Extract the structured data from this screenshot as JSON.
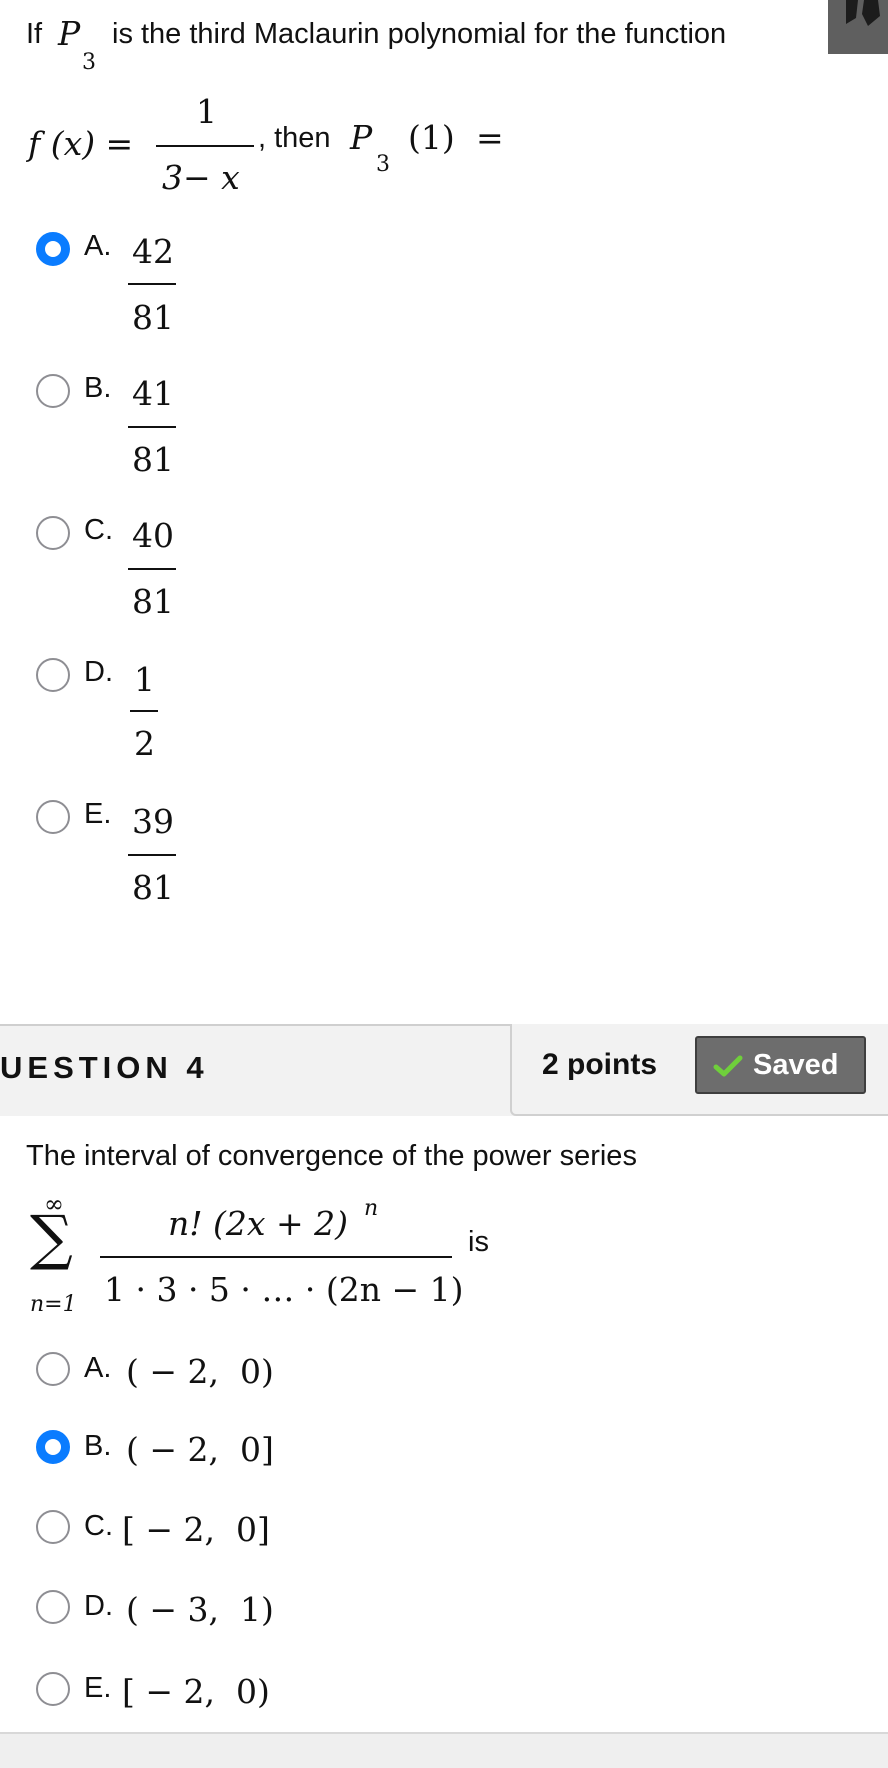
{
  "question3": {
    "text_if": "If",
    "p_symbol": "P",
    "p_subscript": "3",
    "text_rest": "is the third Maclaurin polynomial for the function",
    "f_lhs": "f (x) =",
    "f_num": "1",
    "f_den": "3− x",
    "text_then": ", then",
    "p_eval_symbol": "P",
    "p_eval_subscript": "3",
    "p_eval_arg": "(1)",
    "equals": "=",
    "options": [
      {
        "label": "A.",
        "num": "42",
        "den": "81",
        "selected": true
      },
      {
        "label": "B.",
        "num": "41",
        "den": "81",
        "selected": false
      },
      {
        "label": "C.",
        "num": "40",
        "den": "81",
        "selected": false
      },
      {
        "label": "D.",
        "num": "1",
        "den": "2",
        "selected": false
      },
      {
        "label": "E.",
        "num": "39",
        "den": "81",
        "selected": false
      }
    ]
  },
  "question4": {
    "header_title": "UESTION 4",
    "points": "2 points",
    "saved_label": "Saved",
    "saved_icon": "check-icon",
    "prompt": "The interval of convergence of the power series",
    "sum_upper": "∞",
    "sum_symbol": "∑",
    "sum_lower": "n=1",
    "series_num": "n! (2x + 2)",
    "series_exp": "n",
    "series_den": "1 · 3 · 5 · … · (2n − 1)",
    "suffix": "is",
    "options": [
      {
        "label": "A.",
        "value": "( − 2,  0)",
        "selected": false
      },
      {
        "label": "B.",
        "value": "( − 2,  0]",
        "selected": true
      },
      {
        "label": "C.",
        "value": "[ − 2,  0]",
        "selected": false
      },
      {
        "label": "D.",
        "value": "( − 3,  1)",
        "selected": false
      },
      {
        "label": "E.",
        "value": "[ − 2,  0)",
        "selected": false
      }
    ]
  },
  "colors": {
    "radio_selected": "#0a7cff",
    "radio_unselected": "#8e8e93",
    "saved_bg": "#6d6d6d",
    "check": "#6fcf3b"
  }
}
